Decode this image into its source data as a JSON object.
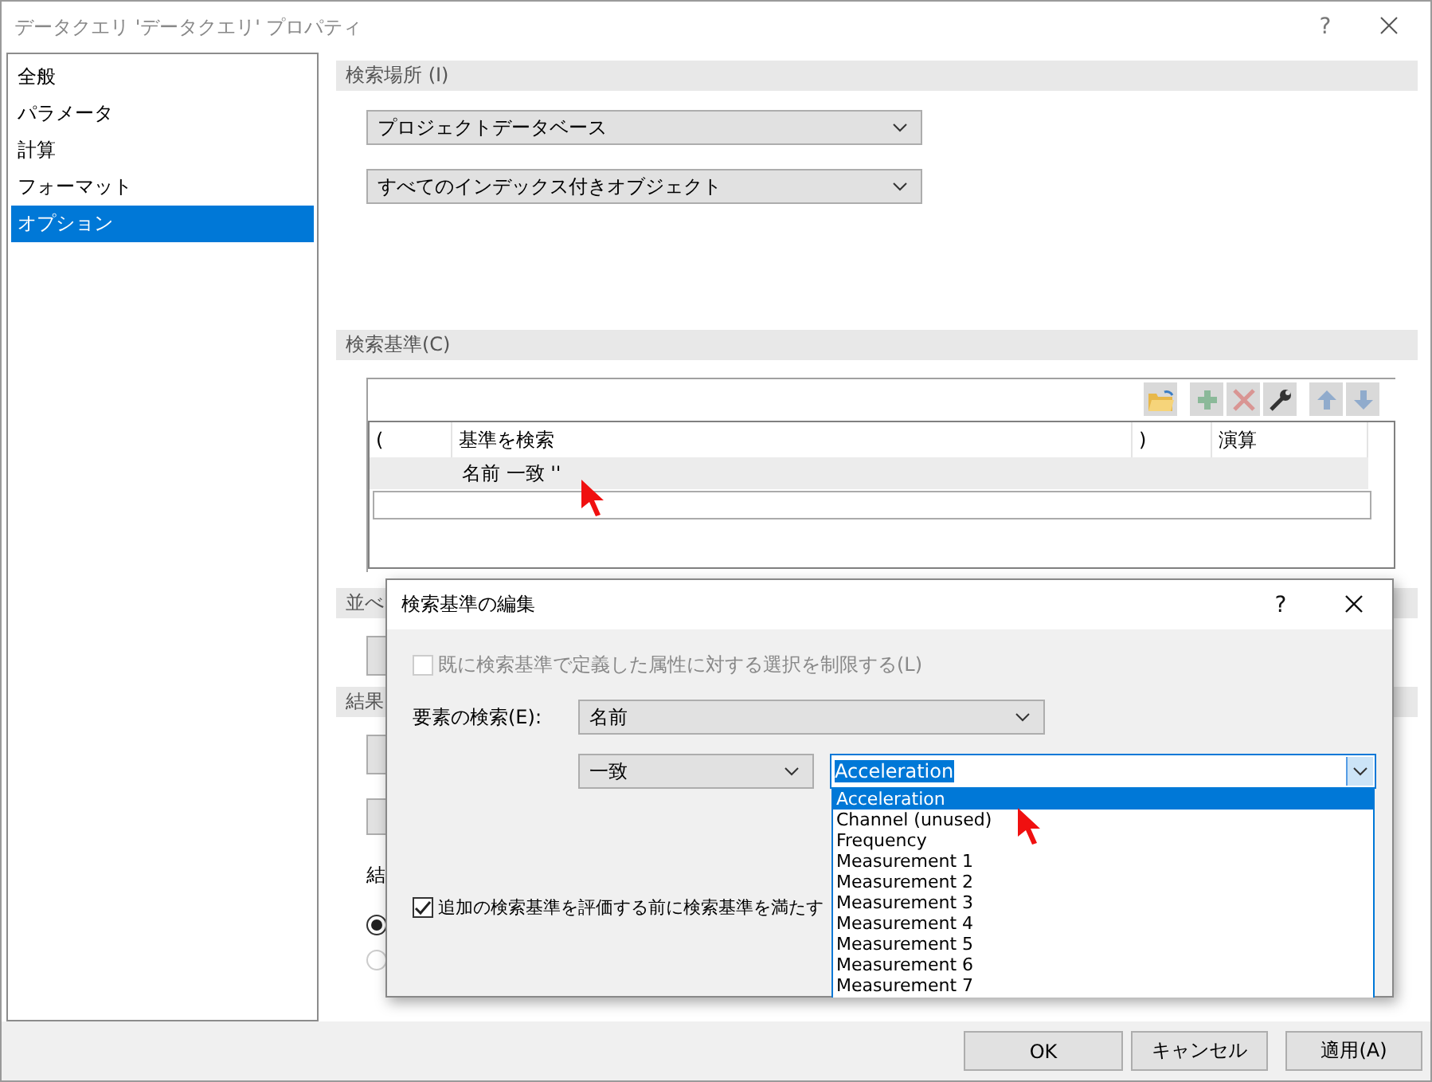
{
  "window": {
    "title": "データクエリ 'データクエリ' プロパティ",
    "help": "?"
  },
  "sidebar": {
    "items": [
      {
        "label": "全般",
        "selected": false
      },
      {
        "label": "パラメータ",
        "selected": false
      },
      {
        "label": "計算",
        "selected": false
      },
      {
        "label": "フォーマット",
        "selected": false
      },
      {
        "label": "オプション",
        "selected": true
      }
    ]
  },
  "search_location": {
    "header": "検索場所 (I)",
    "combos": [
      "プロジェクトデータベース",
      "すべてのインデックス付きオブジェクト"
    ]
  },
  "criteria": {
    "header": "検索基準(C)",
    "toolbar": [
      {
        "kind": "open",
        "disabled": false
      },
      {
        "kind": "add",
        "disabled": true
      },
      {
        "kind": "delete",
        "disabled": true
      },
      {
        "kind": "edit",
        "disabled": false
      },
      {
        "kind": "up",
        "disabled": true
      },
      {
        "kind": "down",
        "disabled": true
      }
    ],
    "columns": [
      "(",
      "基準を検索",
      ")",
      "演算"
    ],
    "rows": [
      {
        "cells": [
          "",
          "名前 一致 ''",
          "",
          ""
        ]
      }
    ]
  },
  "sort": {
    "header": "並べ"
  },
  "results": {
    "header": "結果",
    "label": "結",
    "radios": [
      {
        "selected": true
      },
      {
        "selected": false
      }
    ]
  },
  "buttons": [
    "OK",
    "キャンセル",
    "適用(A)"
  ],
  "dialog": {
    "title": "検索基準の編集",
    "help": "?",
    "restrict": {
      "label": "既に検索基準で定義した属性に対する選択を制限する(L)",
      "checked": false,
      "disabled": true
    },
    "element_label": "要素の検索(E):",
    "element_value": "名前",
    "operator": "一致",
    "value": "Acceleration",
    "options": [
      {
        "label": "Acceleration",
        "selected": true
      },
      {
        "label": "Channel (unused)",
        "selected": false
      },
      {
        "label": "Frequency",
        "selected": false
      },
      {
        "label": "Measurement 1",
        "selected": false
      },
      {
        "label": "Measurement 2",
        "selected": false
      },
      {
        "label": "Measurement 3",
        "selected": false
      },
      {
        "label": "Measurement 4",
        "selected": false
      },
      {
        "label": "Measurement 5",
        "selected": false
      },
      {
        "label": "Measurement 6",
        "selected": false
      },
      {
        "label": "Measurement 7",
        "selected": false
      }
    ],
    "precheck": {
      "label": "追加の検索基準を評価する前に検索基準を満たす",
      "checked": true
    }
  }
}
